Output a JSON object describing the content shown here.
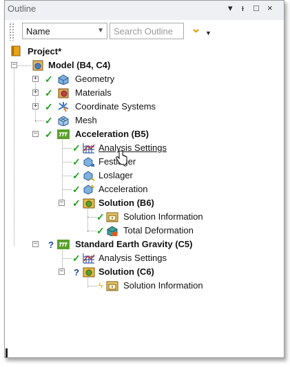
{
  "panel": {
    "title": "Outline",
    "controls": [
      "▾",
      "ᵻ",
      "□",
      "×"
    ]
  },
  "toolbar": {
    "sort_value": "Name",
    "search_placeholder": "Search Outline"
  },
  "tree": {
    "project": "Project*",
    "model": "Model (B4, C4)",
    "geometry": "Geometry",
    "materials": "Materials",
    "coordinate_systems": "Coordinate Systems",
    "mesh": "Mesh",
    "acceleration_b5": "Acceleration (B5)",
    "b5_analysis_settings": "Analysis Settings",
    "festlager": "Festlager",
    "loslager": "Loslager",
    "acceleration": "Acceleration",
    "solution_b6": "Solution (B6)",
    "b6_solution_information": "Solution Information",
    "total_deformation": "Total Deformation",
    "standard_earth_gravity": "Standard Earth Gravity (C5)",
    "c5_analysis_settings": "Analysis Settings",
    "solution_c6": "Solution (C6)",
    "c6_solution_information": "Solution Information"
  },
  "symbols": {
    "check": "✓",
    "question": "?",
    "bolt": "ϟ",
    "expanded": "−",
    "collapsed": "+"
  },
  "colors": {
    "check_green": "#1e9e1e",
    "question_blue": "#1a3fa0",
    "accent_yellow": "#e0a20a"
  }
}
